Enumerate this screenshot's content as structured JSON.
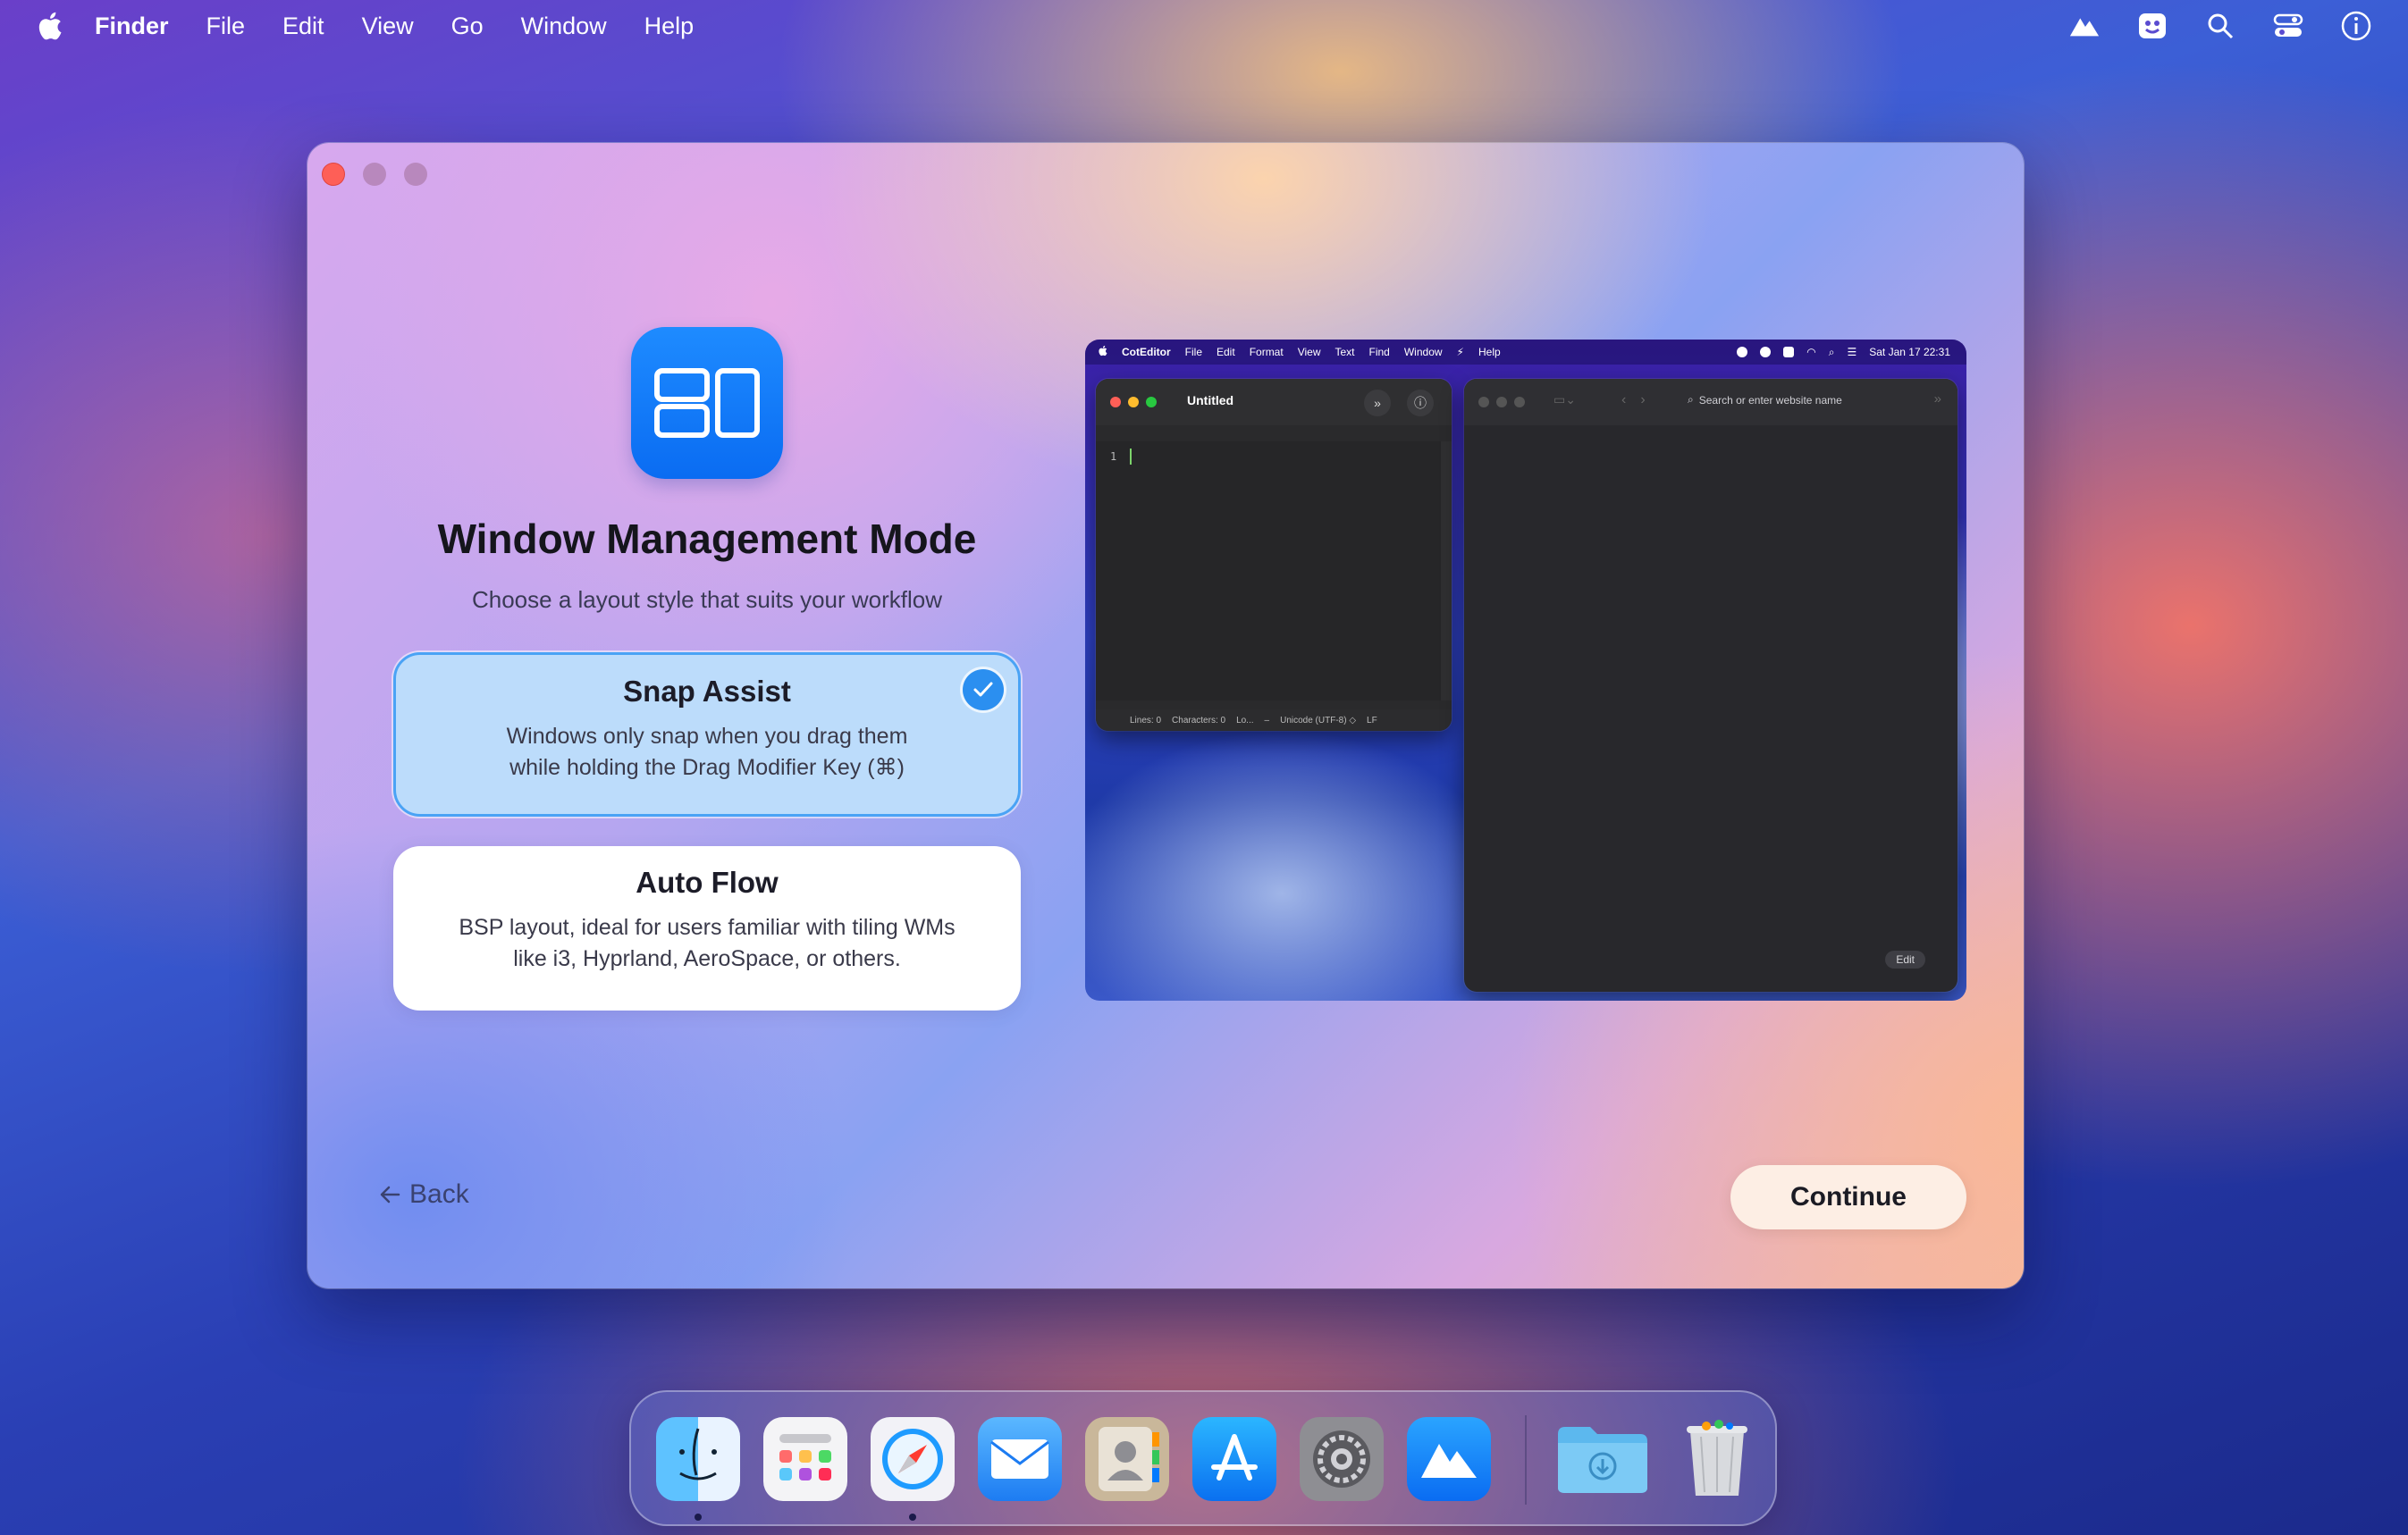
{
  "menubar": {
    "app": "Finder",
    "items": [
      "File",
      "Edit",
      "View",
      "Go",
      "Window",
      "Help"
    ],
    "status_icons": [
      "mountain-icon",
      "assistant-face-icon",
      "search-icon",
      "control-center-icon",
      "info-icon"
    ]
  },
  "window": {
    "title": "Window Management Mode",
    "subtitle": "Choose a layout style that suits your workflow",
    "options": [
      {
        "title": "Snap Assist",
        "line1": "Windows only snap when you drag them",
        "line2": "while holding the Drag Modifier Key (⌘)",
        "selected": true
      },
      {
        "title": "Auto Flow",
        "line1": "BSP layout, ideal for users familiar with tiling WMs",
        "line2": "like i3, Hyprland, AeroSpace, or others.",
        "selected": false
      }
    ],
    "back_label": "Back",
    "continue_label": "Continue"
  },
  "preview": {
    "menubar": {
      "app": "CotEditor",
      "items": [
        "File",
        "Edit",
        "Format",
        "View",
        "Text",
        "Find",
        "Window",
        "⚡",
        "Help"
      ],
      "datetime": "Sat Jan 17  22:31"
    },
    "editor": {
      "title": "Untitled",
      "line_number": "1",
      "status": {
        "lines": "Lines: 0",
        "characters": "Characters: 0",
        "lo": "Lo...",
        "encoding": "Unicode (UTF-8) ◇",
        "line_ending": "LF",
        "dash": "–"
      }
    },
    "browser": {
      "search_placeholder": "Search or enter website name",
      "edit_label": "Edit"
    }
  },
  "dock": {
    "apps": [
      "Finder",
      "Launchpad",
      "Safari",
      "Mail",
      "Contacts",
      "App Store",
      "System Settings",
      "Mountain App",
      "Downloads",
      "Trash"
    ]
  },
  "colors": {
    "accent": "#0a6cf2",
    "selected_bg": "#bcdcfb",
    "selected_border": "#4aa3f5",
    "close_red": "#fe5f57"
  }
}
